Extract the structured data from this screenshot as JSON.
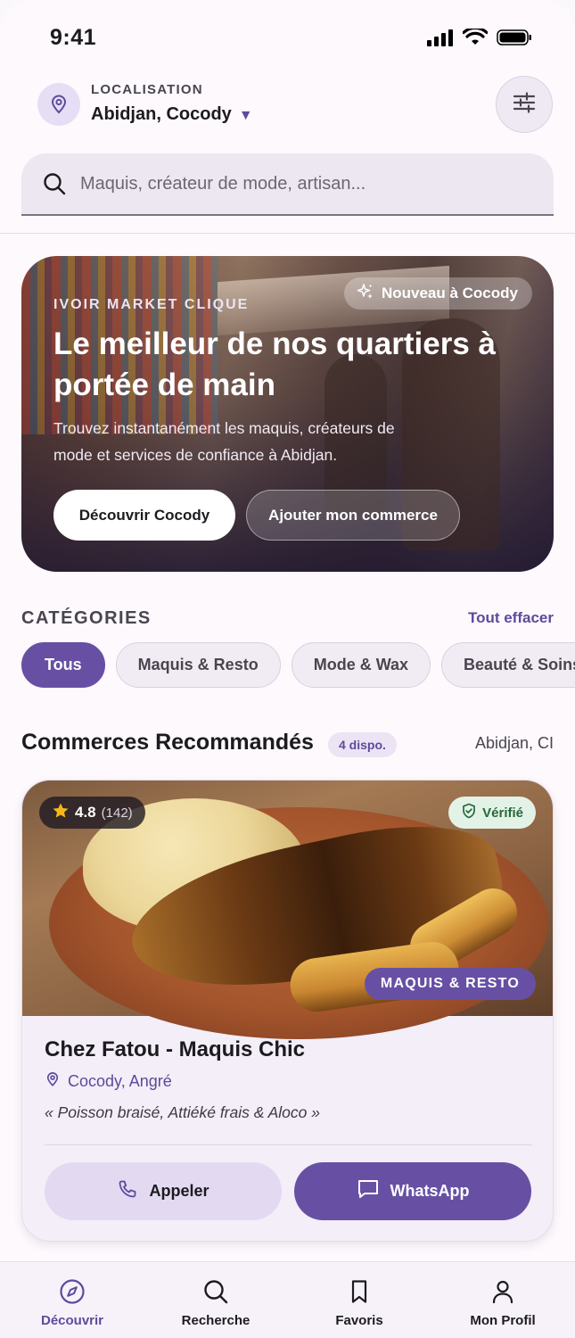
{
  "status_bar": {
    "time": "9:41"
  },
  "header": {
    "location_label": "LOCALISATION",
    "location_value": "Abidjan, Cocody",
    "location_caret": "▼"
  },
  "search": {
    "placeholder": "Maquis, créateur de mode, artisan..."
  },
  "hero": {
    "badge": "Nouveau à Cocody",
    "kicker": "IVOIR MARKET CLIQUE",
    "title": "Le meilleur de nos quartiers à portée de main",
    "description": "Trouvez instantanément les maquis, créateurs de mode et services de confiance à Abidjan.",
    "primary_button": "Découvrir Cocody",
    "secondary_button": "Ajouter mon commerce"
  },
  "categories": {
    "title": "CATÉGORIES",
    "clear_label": "Tout effacer",
    "items": [
      {
        "label": "Tous",
        "active": true
      },
      {
        "label": "Maquis & Resto",
        "active": false
      },
      {
        "label": "Mode & Wax",
        "active": false
      },
      {
        "label": "Beauté & Soins",
        "active": false
      }
    ]
  },
  "recommended": {
    "title": "Commerces Recommandés",
    "count_badge": "4 dispo.",
    "location": "Abidjan, CI"
  },
  "card": {
    "rating": "4.8",
    "rating_count": "(142)",
    "verified_label": "Vérifié",
    "category_tag": "MAQUIS & RESTO",
    "name": "Chez Fatou - Maquis Chic",
    "location": "Cocody, Angré",
    "quote": "« Poisson braisé, Attiéké frais & Aloco »",
    "call_label": "Appeler",
    "whatsapp_label": "WhatsApp"
  },
  "bottom_nav": {
    "items": [
      {
        "label": "Découvrir",
        "icon": "compass-icon",
        "active": true
      },
      {
        "label": "Recherche",
        "icon": "search-icon",
        "active": false
      },
      {
        "label": "Favoris",
        "icon": "bookmark-icon",
        "active": false
      },
      {
        "label": "Mon Profil",
        "icon": "person-icon",
        "active": false
      }
    ]
  },
  "colors": {
    "primary": "#6750a4",
    "primary_text": "#5e4a9c",
    "verified_bg": "#e3f2e6",
    "verified_text": "#24693a",
    "star": "#f6b817"
  }
}
